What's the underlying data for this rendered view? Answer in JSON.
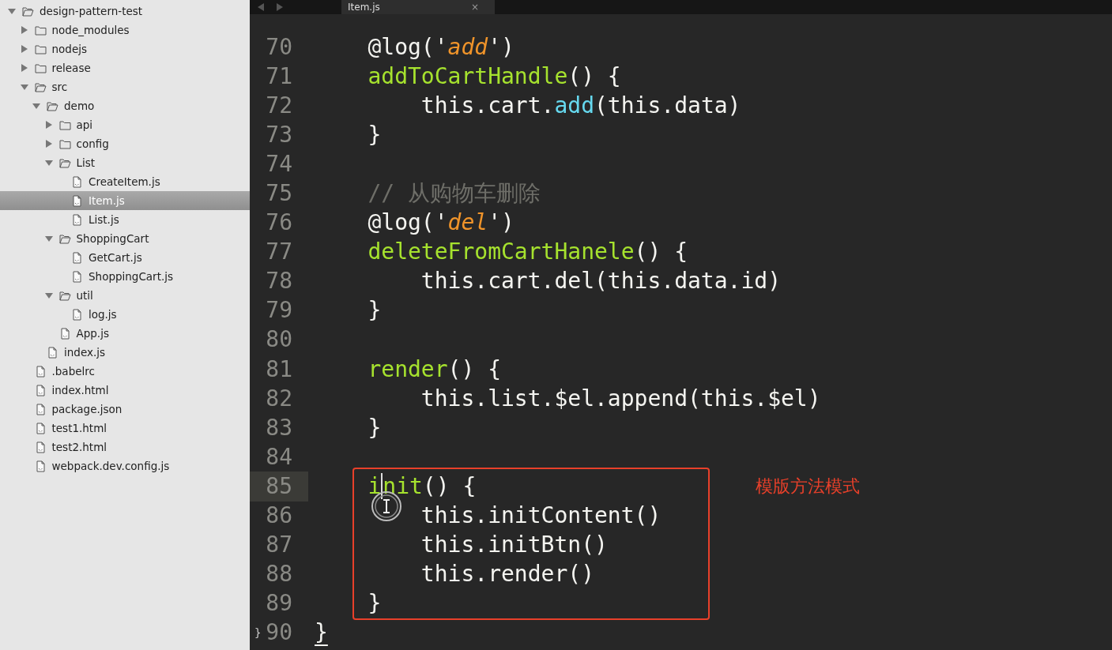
{
  "sidebar": {
    "tree": [
      {
        "label": "design-pattern-test",
        "kind": "folder",
        "expanded": true,
        "selected": false,
        "children": [
          {
            "label": "node_modules",
            "kind": "folder",
            "expanded": false,
            "selected": false
          },
          {
            "label": "nodejs",
            "kind": "folder",
            "expanded": false,
            "selected": false
          },
          {
            "label": "release",
            "kind": "folder",
            "expanded": false,
            "selected": false
          },
          {
            "label": "src",
            "kind": "folder",
            "expanded": true,
            "selected": false,
            "children": [
              {
                "label": "demo",
                "kind": "folder",
                "expanded": true,
                "selected": false,
                "children": [
                  {
                    "label": "api",
                    "kind": "folder",
                    "expanded": false,
                    "selected": false
                  },
                  {
                    "label": "config",
                    "kind": "folder",
                    "expanded": false,
                    "selected": false
                  },
                  {
                    "label": "List",
                    "kind": "folder",
                    "expanded": true,
                    "selected": false,
                    "children": [
                      {
                        "label": "CreateItem.js",
                        "kind": "file",
                        "selected": false
                      },
                      {
                        "label": "Item.js",
                        "kind": "file",
                        "selected": true
                      },
                      {
                        "label": "List.js",
                        "kind": "file",
                        "selected": false
                      }
                    ]
                  },
                  {
                    "label": "ShoppingCart",
                    "kind": "folder",
                    "expanded": true,
                    "selected": false,
                    "children": [
                      {
                        "label": "GetCart.js",
                        "kind": "file",
                        "selected": false
                      },
                      {
                        "label": "ShoppingCart.js",
                        "kind": "file",
                        "selected": false
                      }
                    ]
                  },
                  {
                    "label": "util",
                    "kind": "folder",
                    "expanded": true,
                    "selected": false,
                    "children": [
                      {
                        "label": "log.js",
                        "kind": "file",
                        "selected": false
                      }
                    ]
                  },
                  {
                    "label": "App.js",
                    "kind": "file",
                    "selected": false
                  }
                ]
              },
              {
                "label": "index.js",
                "kind": "file",
                "selected": false
              }
            ]
          },
          {
            "label": ".babelrc",
            "kind": "file",
            "selected": false
          },
          {
            "label": "index.html",
            "kind": "file",
            "selected": false
          },
          {
            "label": "package.json",
            "kind": "file",
            "selected": false
          },
          {
            "label": "test1.html",
            "kind": "file",
            "selected": false
          },
          {
            "label": "test2.html",
            "kind": "file",
            "selected": false
          },
          {
            "label": "webpack.dev.config.js",
            "kind": "file",
            "selected": false
          }
        ]
      }
    ]
  },
  "tabs": [
    {
      "label": "Item.js",
      "close": "×",
      "selected": true
    }
  ],
  "editor": {
    "lines": [
      {
        "number": "70",
        "tokens": [
          {
            "kind": "plain",
            "text": "    @log('"
          },
          {
            "kind": "string",
            "text": "add"
          },
          {
            "kind": "plain",
            "text": "')"
          }
        ]
      },
      {
        "number": "71",
        "tokens": [
          {
            "kind": "func",
            "text": "    addToCartHandle"
          },
          {
            "kind": "plain",
            "text": "() {"
          }
        ]
      },
      {
        "number": "72",
        "tokens": [
          {
            "kind": "plain",
            "text": "        this.cart."
          },
          {
            "kind": "method",
            "text": "add"
          },
          {
            "kind": "plain",
            "text": "(this.data)"
          }
        ]
      },
      {
        "number": "73",
        "tokens": [
          {
            "kind": "plain",
            "text": "    }"
          }
        ]
      },
      {
        "number": "74"
      },
      {
        "number": "75",
        "tokens": [
          {
            "kind": "comment",
            "text": "    // 从购物车删除"
          }
        ]
      },
      {
        "number": "76",
        "tokens": [
          {
            "kind": "plain",
            "text": "    @log('"
          },
          {
            "kind": "string",
            "text": "del"
          },
          {
            "kind": "plain",
            "text": "')"
          }
        ]
      },
      {
        "number": "77",
        "tokens": [
          {
            "kind": "func",
            "text": "    deleteFromCartHanele"
          },
          {
            "kind": "plain",
            "text": "() {"
          }
        ]
      },
      {
        "number": "78",
        "tokens": [
          {
            "kind": "plain",
            "text": "        this.cart.del(this.data.id)"
          }
        ]
      },
      {
        "number": "79",
        "tokens": [
          {
            "kind": "plain",
            "text": "    }"
          }
        ]
      },
      {
        "number": "80"
      },
      {
        "number": "81",
        "tokens": [
          {
            "kind": "func",
            "text": "    render"
          },
          {
            "kind": "plain",
            "text": "() {"
          }
        ]
      },
      {
        "number": "82",
        "tokens": [
          {
            "kind": "plain",
            "text": "        this.list.$el.append(this.$el)"
          }
        ]
      },
      {
        "number": "83",
        "tokens": [
          {
            "kind": "plain",
            "text": "    }"
          }
        ]
      },
      {
        "number": "84"
      },
      {
        "number": "85",
        "current": true,
        "boxed": true,
        "tokens": [
          {
            "kind": "func",
            "text": "    i"
          },
          {
            "kind": "func",
            "text": "nit",
            "caret_before": true
          },
          {
            "kind": "plain",
            "text": "() {"
          }
        ]
      },
      {
        "number": "86",
        "boxed": true,
        "tokens": [
          {
            "kind": "plain",
            "text": "        this.initContent()"
          }
        ]
      },
      {
        "number": "87",
        "boxed": true,
        "tokens": [
          {
            "kind": "plain",
            "text": "        this.initBtn()"
          }
        ]
      },
      {
        "number": "88",
        "boxed": true,
        "tokens": [
          {
            "kind": "plain",
            "text": "        this.render()"
          }
        ]
      },
      {
        "number": "89",
        "boxed": true,
        "tokens": [
          {
            "kind": "plain",
            "text": "    }"
          }
        ]
      },
      {
        "number": "90",
        "fold_marker": "}",
        "tokens": [
          {
            "kind": "match",
            "text": "}"
          }
        ]
      }
    ],
    "annotation": {
      "text": "模版方法模式"
    }
  }
}
